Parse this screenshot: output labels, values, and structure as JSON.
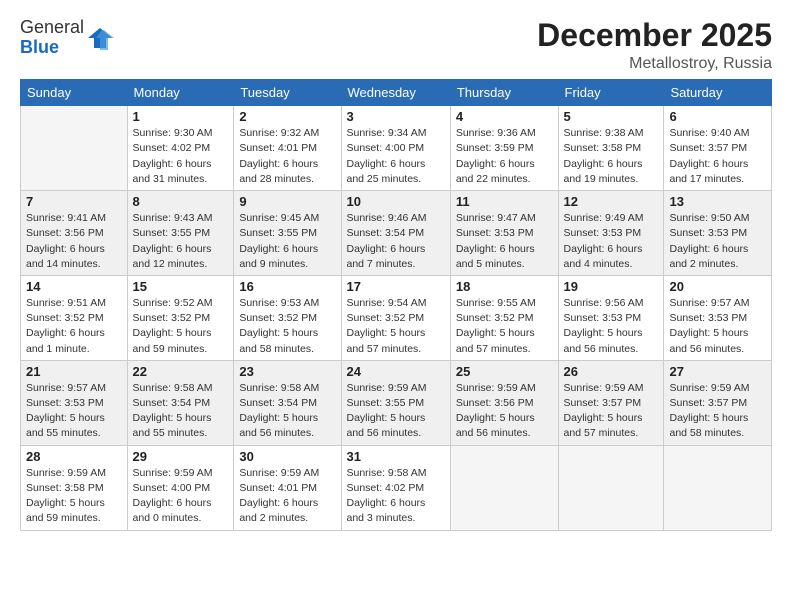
{
  "header": {
    "logo_general": "General",
    "logo_blue": "Blue",
    "month": "December 2025",
    "location": "Metallostroy, Russia"
  },
  "days_of_week": [
    "Sunday",
    "Monday",
    "Tuesday",
    "Wednesday",
    "Thursday",
    "Friday",
    "Saturday"
  ],
  "weeks": [
    [
      {
        "day": "",
        "detail": ""
      },
      {
        "day": "1",
        "detail": "Sunrise: 9:30 AM\nSunset: 4:02 PM\nDaylight: 6 hours\nand 31 minutes."
      },
      {
        "day": "2",
        "detail": "Sunrise: 9:32 AM\nSunset: 4:01 PM\nDaylight: 6 hours\nand 28 minutes."
      },
      {
        "day": "3",
        "detail": "Sunrise: 9:34 AM\nSunset: 4:00 PM\nDaylight: 6 hours\nand 25 minutes."
      },
      {
        "day": "4",
        "detail": "Sunrise: 9:36 AM\nSunset: 3:59 PM\nDaylight: 6 hours\nand 22 minutes."
      },
      {
        "day": "5",
        "detail": "Sunrise: 9:38 AM\nSunset: 3:58 PM\nDaylight: 6 hours\nand 19 minutes."
      },
      {
        "day": "6",
        "detail": "Sunrise: 9:40 AM\nSunset: 3:57 PM\nDaylight: 6 hours\nand 17 minutes."
      }
    ],
    [
      {
        "day": "7",
        "detail": "Sunrise: 9:41 AM\nSunset: 3:56 PM\nDaylight: 6 hours\nand 14 minutes."
      },
      {
        "day": "8",
        "detail": "Sunrise: 9:43 AM\nSunset: 3:55 PM\nDaylight: 6 hours\nand 12 minutes."
      },
      {
        "day": "9",
        "detail": "Sunrise: 9:45 AM\nSunset: 3:55 PM\nDaylight: 6 hours\nand 9 minutes."
      },
      {
        "day": "10",
        "detail": "Sunrise: 9:46 AM\nSunset: 3:54 PM\nDaylight: 6 hours\nand 7 minutes."
      },
      {
        "day": "11",
        "detail": "Sunrise: 9:47 AM\nSunset: 3:53 PM\nDaylight: 6 hours\nand 5 minutes."
      },
      {
        "day": "12",
        "detail": "Sunrise: 9:49 AM\nSunset: 3:53 PM\nDaylight: 6 hours\nand 4 minutes."
      },
      {
        "day": "13",
        "detail": "Sunrise: 9:50 AM\nSunset: 3:53 PM\nDaylight: 6 hours\nand 2 minutes."
      }
    ],
    [
      {
        "day": "14",
        "detail": "Sunrise: 9:51 AM\nSunset: 3:52 PM\nDaylight: 6 hours\nand 1 minute."
      },
      {
        "day": "15",
        "detail": "Sunrise: 9:52 AM\nSunset: 3:52 PM\nDaylight: 5 hours\nand 59 minutes."
      },
      {
        "day": "16",
        "detail": "Sunrise: 9:53 AM\nSunset: 3:52 PM\nDaylight: 5 hours\nand 58 minutes."
      },
      {
        "day": "17",
        "detail": "Sunrise: 9:54 AM\nSunset: 3:52 PM\nDaylight: 5 hours\nand 57 minutes."
      },
      {
        "day": "18",
        "detail": "Sunrise: 9:55 AM\nSunset: 3:52 PM\nDaylight: 5 hours\nand 57 minutes."
      },
      {
        "day": "19",
        "detail": "Sunrise: 9:56 AM\nSunset: 3:53 PM\nDaylight: 5 hours\nand 56 minutes."
      },
      {
        "day": "20",
        "detail": "Sunrise: 9:57 AM\nSunset: 3:53 PM\nDaylight: 5 hours\nand 56 minutes."
      }
    ],
    [
      {
        "day": "21",
        "detail": "Sunrise: 9:57 AM\nSunset: 3:53 PM\nDaylight: 5 hours\nand 55 minutes."
      },
      {
        "day": "22",
        "detail": "Sunrise: 9:58 AM\nSunset: 3:54 PM\nDaylight: 5 hours\nand 55 minutes."
      },
      {
        "day": "23",
        "detail": "Sunrise: 9:58 AM\nSunset: 3:54 PM\nDaylight: 5 hours\nand 56 minutes."
      },
      {
        "day": "24",
        "detail": "Sunrise: 9:59 AM\nSunset: 3:55 PM\nDaylight: 5 hours\nand 56 minutes."
      },
      {
        "day": "25",
        "detail": "Sunrise: 9:59 AM\nSunset: 3:56 PM\nDaylight: 5 hours\nand 56 minutes."
      },
      {
        "day": "26",
        "detail": "Sunrise: 9:59 AM\nSunset: 3:57 PM\nDaylight: 5 hours\nand 57 minutes."
      },
      {
        "day": "27",
        "detail": "Sunrise: 9:59 AM\nSunset: 3:57 PM\nDaylight: 5 hours\nand 58 minutes."
      }
    ],
    [
      {
        "day": "28",
        "detail": "Sunrise: 9:59 AM\nSunset: 3:58 PM\nDaylight: 5 hours\nand 59 minutes."
      },
      {
        "day": "29",
        "detail": "Sunrise: 9:59 AM\nSunset: 4:00 PM\nDaylight: 6 hours\nand 0 minutes."
      },
      {
        "day": "30",
        "detail": "Sunrise: 9:59 AM\nSunset: 4:01 PM\nDaylight: 6 hours\nand 2 minutes."
      },
      {
        "day": "31",
        "detail": "Sunrise: 9:58 AM\nSunset: 4:02 PM\nDaylight: 6 hours\nand 3 minutes."
      },
      {
        "day": "",
        "detail": ""
      },
      {
        "day": "",
        "detail": ""
      },
      {
        "day": "",
        "detail": ""
      }
    ]
  ]
}
